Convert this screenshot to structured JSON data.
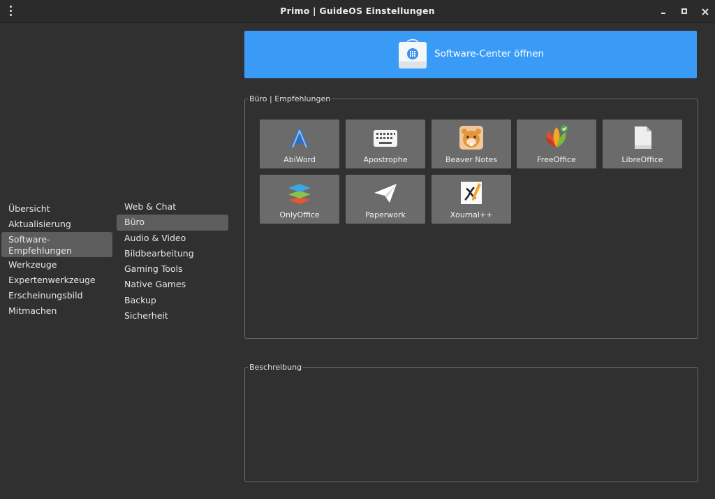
{
  "window": {
    "title": "Primo | GuideOS Einstellungen"
  },
  "titlebar_icons": {
    "menu": "kebab-menu-icon",
    "minimize": "minimize-icon",
    "maximize": "maximize-icon",
    "close": "close-icon"
  },
  "categories": [
    {
      "label": "Übersicht"
    },
    {
      "label": "Aktualisierung"
    },
    {
      "label": "Software-\nEmpfehlungen",
      "active": true
    },
    {
      "label": "Werkzeuge"
    },
    {
      "label": "Expertenwerkzeuge"
    },
    {
      "label": "Erscheinungsbild"
    },
    {
      "label": "Mitmachen"
    }
  ],
  "subcategories": [
    {
      "label": "Web & Chat"
    },
    {
      "label": "Büro",
      "active": true
    },
    {
      "label": "Audio & Video"
    },
    {
      "label": "Bildbearbeitung"
    },
    {
      "label": "Gaming Tools"
    },
    {
      "label": "Native Games"
    },
    {
      "label": "Backup"
    },
    {
      "label": "Sicherheit"
    }
  ],
  "software_center": {
    "label": "Software-Center öffnen",
    "icon": "software-store-icon",
    "color": "#3a9bf7"
  },
  "recommendations": {
    "legend": "Büro | Empfehlungen",
    "apps": [
      {
        "label": "AbiWord",
        "icon": "abiword-icon"
      },
      {
        "label": "Apostrophe",
        "icon": "apostrophe-icon"
      },
      {
        "label": "Beaver Notes",
        "icon": "beaver-notes-icon"
      },
      {
        "label": "FreeOffice",
        "icon": "freeoffice-icon"
      },
      {
        "label": "LibreOffice",
        "icon": "libreoffice-icon"
      },
      {
        "label": "OnlyOffice",
        "icon": "onlyoffice-icon"
      },
      {
        "label": "Paperwork",
        "icon": "paperwork-icon"
      },
      {
        "label": "Xournal++",
        "icon": "xournalpp-icon"
      }
    ]
  },
  "description": {
    "legend": "Beschreibung",
    "text": ""
  },
  "colors": {
    "background": "#303030",
    "active_item": "#5d5d5d",
    "tile": "#6b6b6b"
  }
}
